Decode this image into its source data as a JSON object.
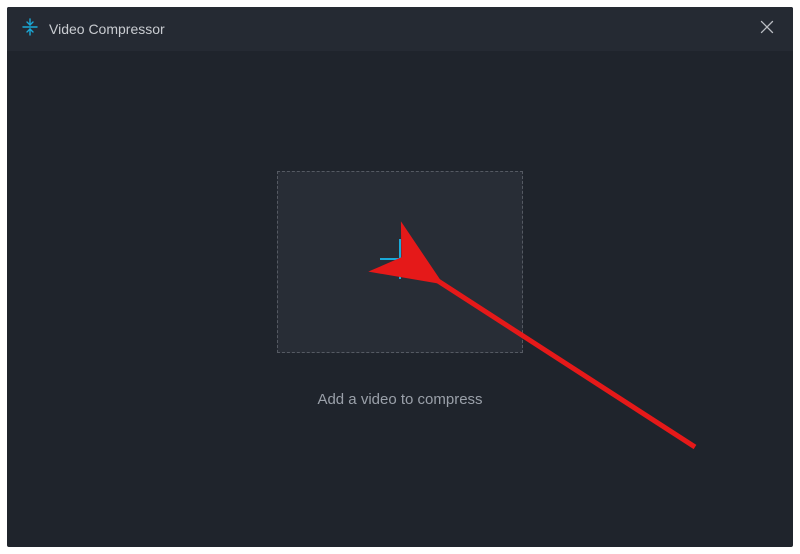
{
  "titlebar": {
    "title": "Video Compressor"
  },
  "main": {
    "hint": "Add a video to compress"
  },
  "colors": {
    "accent": "#1aa9d8",
    "accent_light": "#48c1e8",
    "annotation": "#e51919"
  }
}
